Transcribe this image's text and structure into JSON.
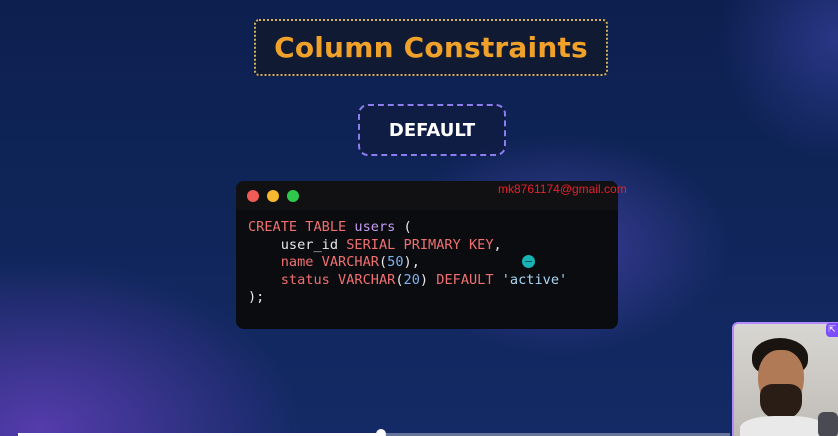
{
  "slide": {
    "title": "Column Constraints",
    "subtitle_badge": "DEFAULT"
  },
  "code_window": {
    "window_controls": [
      "close",
      "minimize",
      "maximize"
    ],
    "lines": [
      [
        {
          "t": "kw",
          "v": "CREATE TABLE "
        },
        {
          "t": "tbl",
          "v": "users"
        },
        {
          "t": "pl",
          "v": " ("
        }
      ],
      [
        {
          "t": "pl",
          "v": "    user_id "
        },
        {
          "t": "kw",
          "v": "SERIAL PRIMARY KEY"
        },
        {
          "t": "pl",
          "v": ","
        }
      ],
      [
        {
          "t": "pl",
          "v": "    "
        },
        {
          "t": "kw",
          "v": "name VARCHAR"
        },
        {
          "t": "pl",
          "v": "("
        },
        {
          "t": "num",
          "v": "50"
        },
        {
          "t": "pl",
          "v": "),"
        }
      ],
      [
        {
          "t": "pl",
          "v": "    "
        },
        {
          "t": "kw",
          "v": "status VARCHAR"
        },
        {
          "t": "pl",
          "v": "("
        },
        {
          "t": "num",
          "v": "20"
        },
        {
          "t": "pl",
          "v": ") "
        },
        {
          "t": "kw",
          "v": "DEFAULT "
        },
        {
          "t": "str",
          "v": "'active'"
        }
      ],
      [
        {
          "t": "pl",
          "v": ");"
        }
      ]
    ]
  },
  "watermark": "mk8761174@gmail.com",
  "webcam": {
    "badge_icon": "expand-icon",
    "badge_glyph": "⇱"
  },
  "video_progress": {
    "fraction": 0.51
  },
  "colors": {
    "title": "#f0a12a",
    "keyword": "#f07070",
    "table_name": "#c59cf2",
    "number": "#7fb2f0",
    "string": "#a9d6f5",
    "watermark": "#e8202a"
  }
}
